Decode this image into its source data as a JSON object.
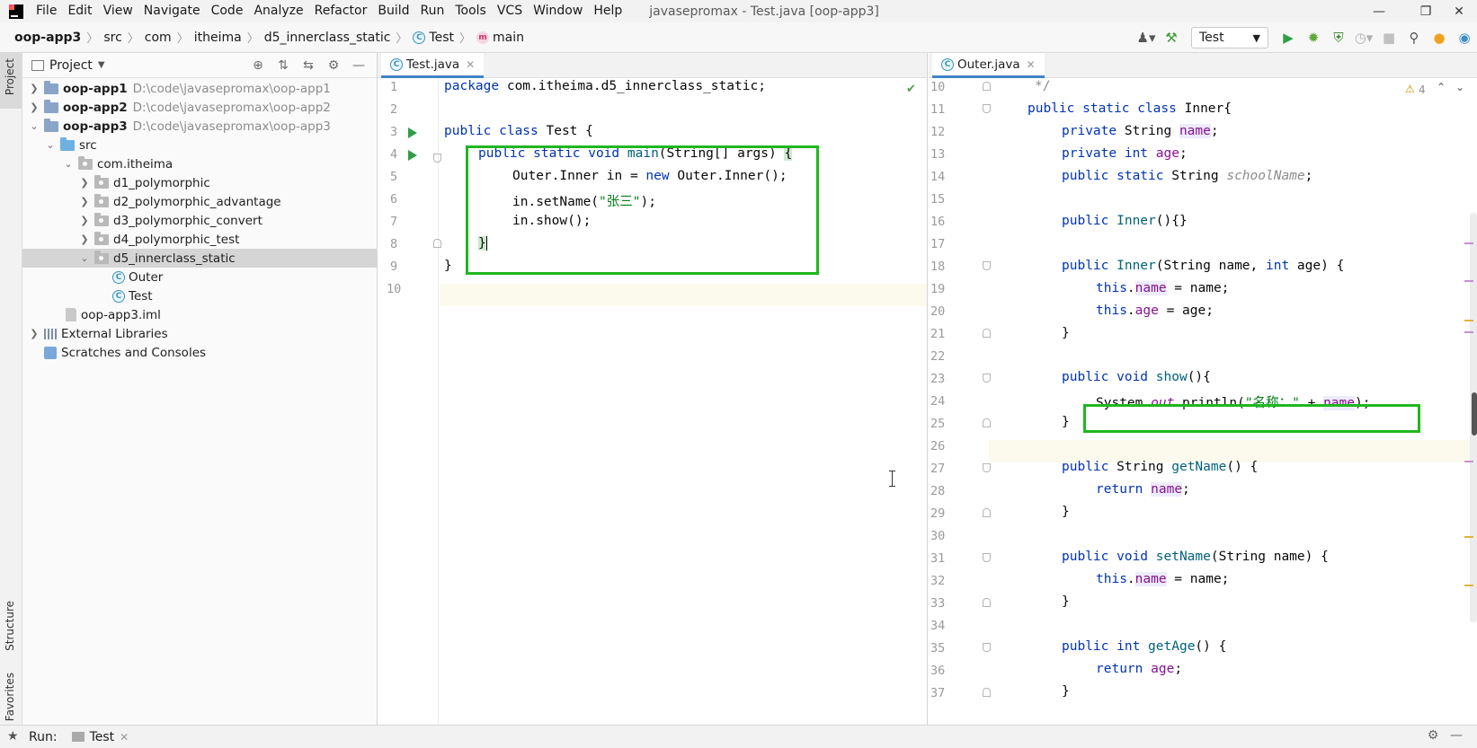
{
  "menu": {
    "items": [
      "File",
      "Edit",
      "View",
      "Navigate",
      "Code",
      "Analyze",
      "Refactor",
      "Build",
      "Run",
      "Tools",
      "VCS",
      "Window",
      "Help"
    ],
    "window_title": "javasepromax - Test.java [oop-app3]"
  },
  "breadcrumb": {
    "items": [
      "oop-app3",
      "src",
      "com",
      "itheima",
      "d5_innerclass_static",
      "Test",
      "main"
    ]
  },
  "toolbar": {
    "run_config": "Test"
  },
  "project": {
    "title": "Project",
    "tree": [
      {
        "label": "oop-app1",
        "path": "D:\\code\\javasepromax\\oop-app1"
      },
      {
        "label": "oop-app2",
        "path": "D:\\code\\javasepromax\\oop-app2"
      },
      {
        "label": "oop-app3",
        "path": "D:\\code\\javasepromax\\oop-app3"
      },
      {
        "label": "src"
      },
      {
        "label": "com.itheima"
      },
      {
        "label": "d1_polymorphic"
      },
      {
        "label": "d2_polymorphic_advantage"
      },
      {
        "label": "d3_polymorphic_convert"
      },
      {
        "label": "d4_polymorphic_test"
      },
      {
        "label": "d5_innerclass_static"
      },
      {
        "label": "Outer"
      },
      {
        "label": "Test"
      },
      {
        "label": "oop-app3.iml"
      },
      {
        "label": "External Libraries"
      },
      {
        "label": "Scratches and Consoles"
      }
    ]
  },
  "side_tabs": {
    "project": "Project",
    "structure": "Structure",
    "favorites": "Favorites"
  },
  "editor_left": {
    "tab": "Test.java",
    "line_numbers": [
      "1",
      "2",
      "3",
      "4",
      "5",
      "6",
      "7",
      "8",
      "9",
      "10"
    ],
    "code": {
      "l1_kw": "package",
      "l1_rest": " com.itheima.d5_innerclass_static;",
      "l3_kw": "public class",
      "l3_rest": " Test {",
      "l4_kw": "public static void",
      "l4_m": "main",
      "l4_rest": "(String[] args) ",
      "l4_brace": "{",
      "l5_a": "Outer.Inner in = ",
      "l5_kw": "new",
      "l5_b": " Outer.Inner();",
      "l6_a": "in.setName(",
      "l6_str": "\"张三\"",
      "l6_b": ");",
      "l7": "in.show();",
      "l8": "}",
      "l9": "}"
    }
  },
  "editor_right": {
    "tab": "Outer.java",
    "warnings": "4",
    "line_numbers": [
      "10",
      "11",
      "12",
      "13",
      "14",
      "15",
      "16",
      "17",
      "18",
      "19",
      "20",
      "21",
      "22",
      "23",
      "24",
      "25",
      "26",
      "27",
      "28",
      "29",
      "30",
      "31",
      "32",
      "33",
      "34",
      "35",
      "36",
      "37"
    ],
    "code": {
      "l10": "*/",
      "l11_kw": "public static class",
      "l11_rest": " Inner{",
      "l12_kw": "private",
      "l12_t": " String ",
      "l12_f": "name",
      "l12_e": ";",
      "l13_kw": "private int",
      "l13_sp": " ",
      "l13_f": "age",
      "l13_e": ";",
      "l14_kw": "public static",
      "l14_t": " String ",
      "l14_f": "schoolName",
      "l14_e": ";",
      "l16_kw": "public",
      "l16_m": " Inner",
      "l16_e": "(){}",
      "l18_kw": "public",
      "l18_m": " Inner",
      "l18_a": "(String name, ",
      "l18_kw2": "int",
      "l18_b": " age) {",
      "l19_kw": "this",
      "l19_d": ".",
      "l19_f": "name",
      "l19_e": " = name;",
      "l20_kw": "this",
      "l20_d": ".",
      "l20_f": "age",
      "l20_e": " = age;",
      "l21": "}",
      "l23_kw": "public void",
      "l23_m": " show",
      "l23_e": "(){",
      "l24_a": "System.",
      "l24_f": "out",
      "l24_b": ".println(",
      "l24_str": "\"名称：\"",
      "l24_c": " + ",
      "l24_fn": "name",
      "l24_e": ");",
      "l25": "}",
      "l27_kw": "public",
      "l27_t": " String ",
      "l27_m": "getName",
      "l27_e": "() {",
      "l28_kw": "return",
      "l28_sp": " ",
      "l28_f": "name",
      "l28_e": ";",
      "l29": "}",
      "l31_kw": "public void",
      "l31_m": " setName",
      "l31_e": "(String name) {",
      "l32_kw": "this",
      "l32_d": ".",
      "l32_f": "name",
      "l32_e": " = name;",
      "l33": "}",
      "l35_kw": "public int",
      "l35_m": " getAge",
      "l35_e": "() {",
      "l36_kw": "return",
      "l36_sp": " ",
      "l36_f": "age",
      "l36_e": ";",
      "l37": "}"
    }
  },
  "runbar": {
    "label": "Run:",
    "tab": "Test"
  },
  "colors": {
    "highlight_box": "#1fb71f",
    "keyword": "#0033b3",
    "string": "#067d17",
    "field": "#871094",
    "method": "#00627a"
  }
}
